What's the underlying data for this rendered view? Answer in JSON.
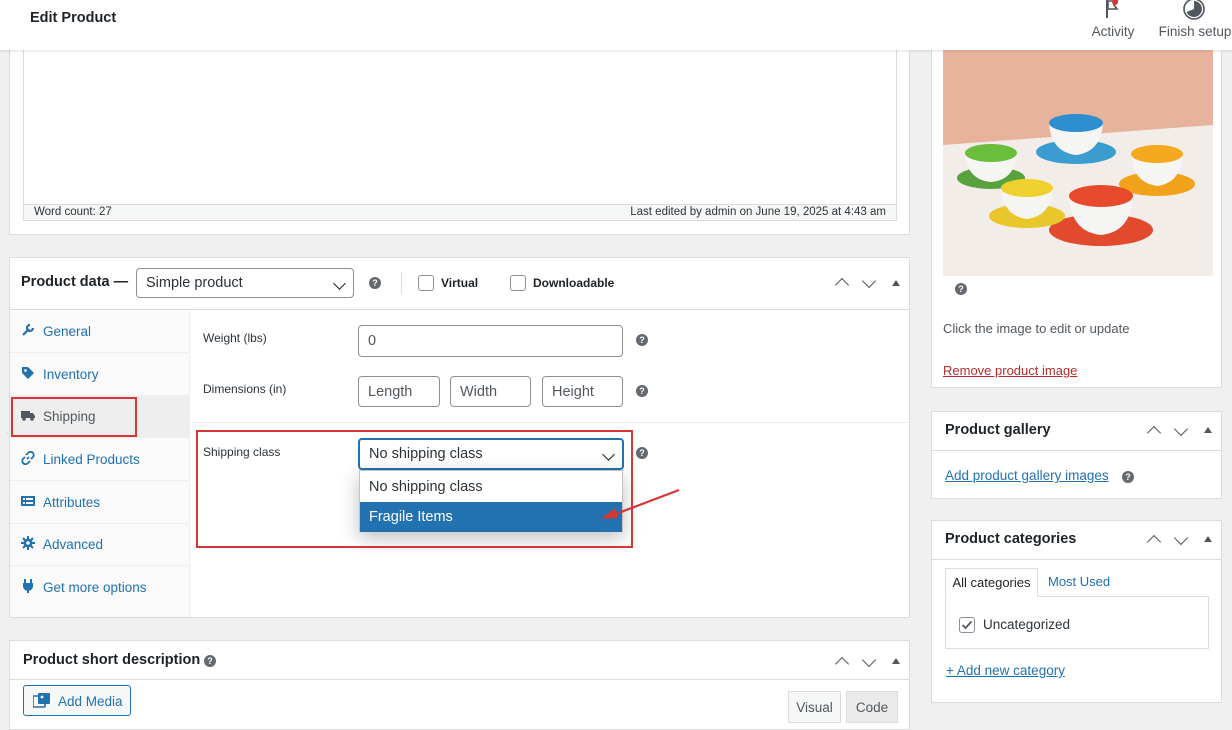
{
  "header": {
    "title": "Edit Product",
    "activity_label": "Activity",
    "finish_setup_label": "Finish setup"
  },
  "editor": {
    "word_count": "Word count: 27",
    "last_edited": "Last edited by admin on June 19, 2025 at 4:43 am"
  },
  "product_data": {
    "title": "Product data —",
    "type_value": "Simple product",
    "virtual_label": "Virtual",
    "downloadable_label": "Downloadable",
    "tabs": [
      {
        "label": "General",
        "icon": "wrench-icon"
      },
      {
        "label": "Inventory",
        "icon": "tag-icon"
      },
      {
        "label": "Shipping",
        "icon": "truck-icon"
      },
      {
        "label": "Linked Products",
        "icon": "link-icon"
      },
      {
        "label": "Attributes",
        "icon": "list-icon"
      },
      {
        "label": "Advanced",
        "icon": "gear-icon"
      },
      {
        "label": "Get more options",
        "icon": "plugin-icon"
      }
    ],
    "active_tab": "Shipping",
    "weight_label": "Weight (lbs)",
    "weight_value": "0",
    "dimensions_label": "Dimensions (in)",
    "length_placeholder": "Length",
    "width_placeholder": "Width",
    "height_placeholder": "Height",
    "shipping_class_label": "Shipping class",
    "shipping_class_value": "No shipping class",
    "shipping_class_options": [
      "No shipping class",
      "Fragile Items"
    ],
    "highlighted_option": "Fragile Items"
  },
  "short_description": {
    "title": "Product short description",
    "add_media_label": "Add Media",
    "visual_tab": "Visual",
    "code_tab": "Code"
  },
  "product_image": {
    "hint": "Click the image to edit or update",
    "remove_label": "Remove product image"
  },
  "gallery": {
    "title": "Product gallery",
    "add_label": "Add product gallery images"
  },
  "categories": {
    "title": "Product categories",
    "tab_all": "All categories",
    "tab_most_used": "Most Used",
    "items": [
      {
        "label": "Uncategorized",
        "checked": true
      }
    ],
    "add_label": "+ Add new category"
  },
  "colors": {
    "accent": "#2271b1",
    "annotation": "#d63638",
    "selected_option": "#2271b1"
  }
}
